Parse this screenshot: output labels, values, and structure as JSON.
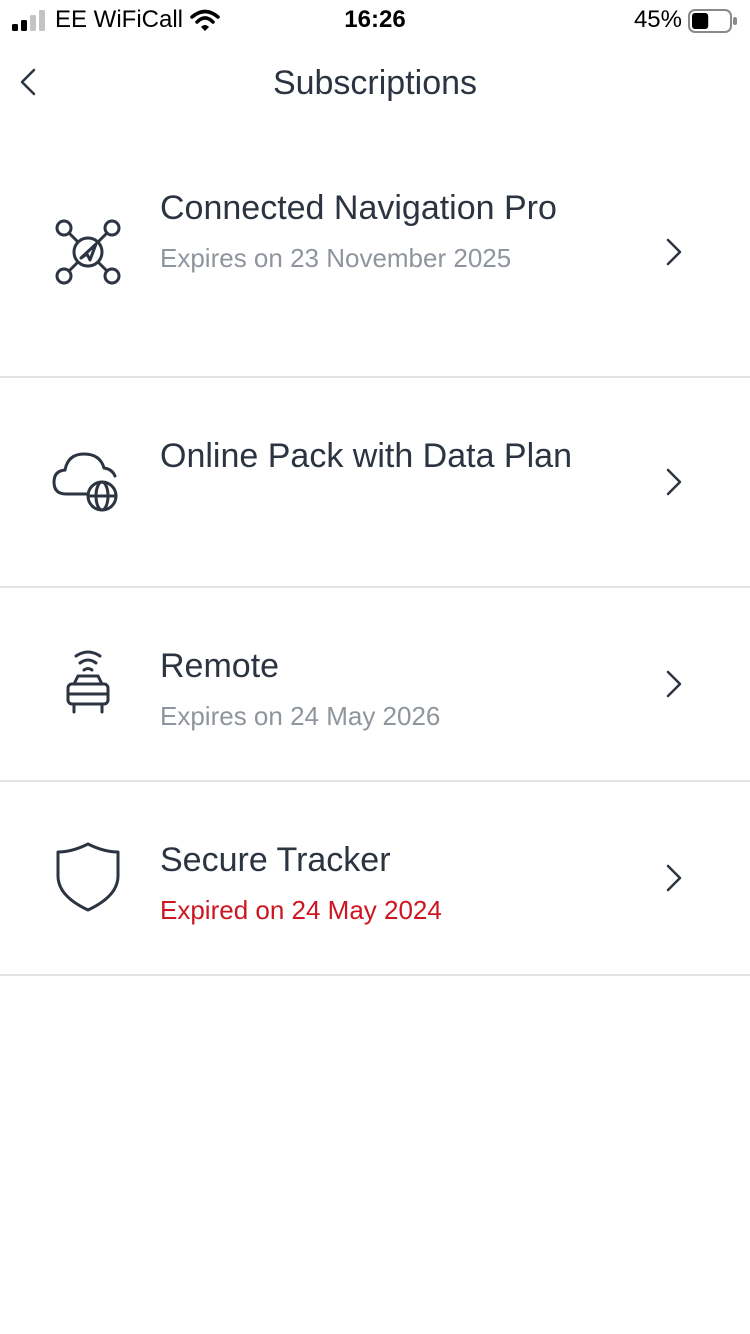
{
  "status_bar": {
    "carrier": "EE WiFiCall",
    "time": "16:26",
    "battery_percent": "45%",
    "battery_level": 0.45,
    "signal_bars": 2
  },
  "header": {
    "title": "Subscriptions",
    "back_icon": "chevron-left-icon"
  },
  "subscriptions": [
    {
      "title": "Connected Navigation Pro",
      "subtitle": "Expires on 23 November 2025",
      "status": "active",
      "icon": "connected-navigation-icon"
    },
    {
      "title": "Online Pack with Data Plan",
      "subtitle": "",
      "status": "active",
      "icon": "cloud-globe-icon"
    },
    {
      "title": "Remote",
      "subtitle": "Expires on 24 May 2026",
      "status": "active",
      "icon": "remote-car-icon"
    },
    {
      "title": "Secure Tracker",
      "subtitle": "Expired on 24 May 2024",
      "status": "expired",
      "icon": "shield-icon"
    }
  ],
  "colors": {
    "text": "#2b3440",
    "subtitle": "#8f959c",
    "expired": "#cc1621",
    "divider": "#e3e3e3"
  }
}
